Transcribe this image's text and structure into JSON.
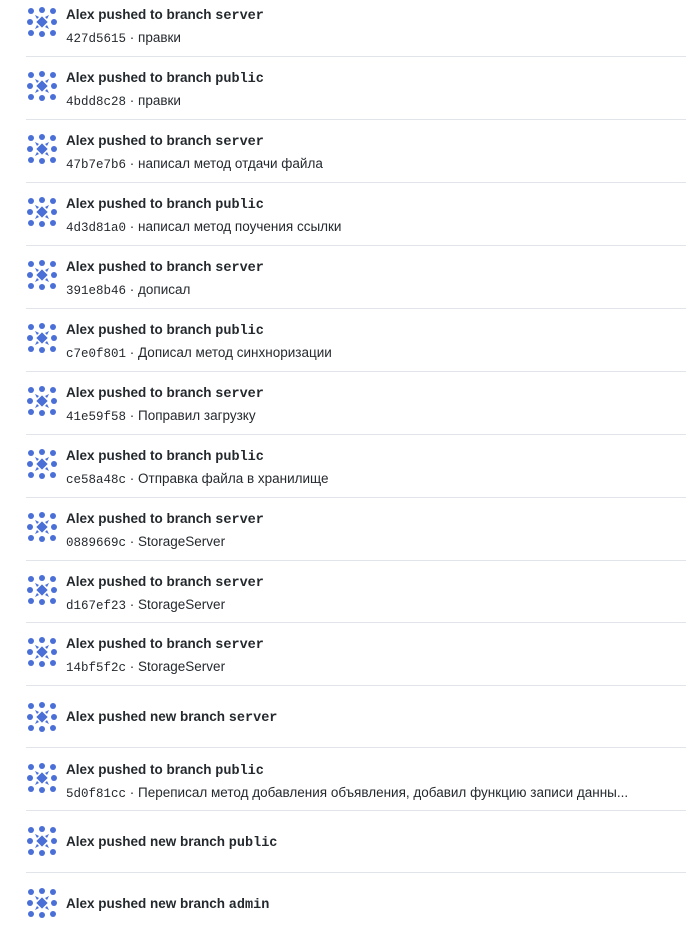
{
  "feed": {
    "items": [
      {
        "title_prefix": "Alex pushed to branch ",
        "branch": "server",
        "sha": "427d5615",
        "sep": " · ",
        "message": "правки"
      },
      {
        "title_prefix": "Alex pushed to branch ",
        "branch": "public",
        "sha": "4bdd8c28",
        "sep": " · ",
        "message": "правки"
      },
      {
        "title_prefix": "Alex pushed to branch ",
        "branch": "server",
        "sha": "47b7e7b6",
        "sep": " · ",
        "message": "написал метод отдачи файла"
      },
      {
        "title_prefix": "Alex pushed to branch ",
        "branch": "public",
        "sha": "4d3d81a0",
        "sep": " · ",
        "message": "написал метод поучения ссылки"
      },
      {
        "title_prefix": "Alex pushed to branch ",
        "branch": "server",
        "sha": "391e8b46",
        "sep": " · ",
        "message": "дописал"
      },
      {
        "title_prefix": "Alex pushed to branch ",
        "branch": "public",
        "sha": "c7e0f801",
        "sep": " · ",
        "message": "Дописал метод синхноризации"
      },
      {
        "title_prefix": "Alex pushed to branch ",
        "branch": "server",
        "sha": "41e59f58",
        "sep": " · ",
        "message": "Поправил загрузку"
      },
      {
        "title_prefix": "Alex pushed to branch ",
        "branch": "public",
        "sha": "ce58a48c",
        "sep": " · ",
        "message": "Отправка файла в хранилище"
      },
      {
        "title_prefix": "Alex pushed to branch ",
        "branch": "server",
        "sha": "0889669c",
        "sep": " · ",
        "message": "StorageServer"
      },
      {
        "title_prefix": "Alex pushed to branch ",
        "branch": "server",
        "sha": "d167ef23",
        "sep": " · ",
        "message": "StorageServer"
      },
      {
        "title_prefix": "Alex pushed to branch ",
        "branch": "server",
        "sha": "14bf5f2c",
        "sep": " · ",
        "message": "StorageServer"
      },
      {
        "title_prefix": "Alex pushed new branch ",
        "branch": "server"
      },
      {
        "title_prefix": "Alex pushed to branch ",
        "branch": "public",
        "sha": "5d0f81cc",
        "sep": " · ",
        "message": "Переписал метод добавления объявления, добавил функцию записи данны..."
      },
      {
        "title_prefix": "Alex pushed new branch ",
        "branch": "public"
      },
      {
        "title_prefix": "Alex pushed new branch ",
        "branch": "admin"
      }
    ]
  },
  "avatar": {
    "icon": "identicon-icon",
    "color": "#4a6fd6"
  }
}
